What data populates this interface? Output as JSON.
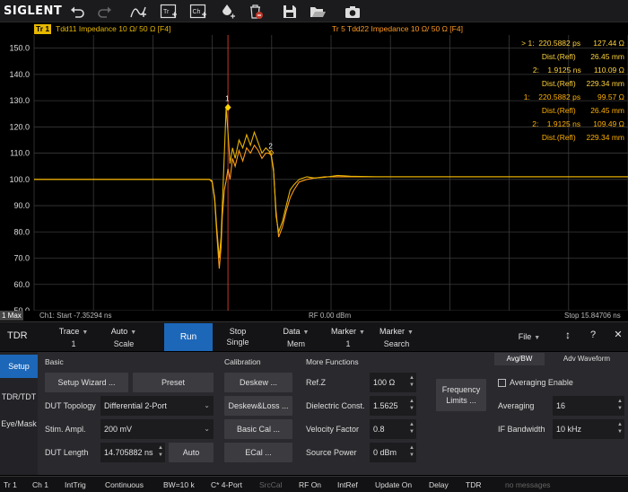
{
  "toolbar": {
    "logo": "SIGLENT",
    "icons": [
      "undo-icon",
      "redo-icon",
      "autoscale-icon",
      "trace-icon",
      "channel-icon",
      "marker-icon",
      "delete-icon",
      "save-icon",
      "open-icon",
      "screenshot-icon"
    ],
    "trace_badge": "Tr",
    "channel_badge": "Ch"
  },
  "trace_header": {
    "tr1_badge": "Tr 1",
    "tr1_text": "Tdd11 Impedance 10 Ω/ 50 Ω [F4]",
    "tr5_text": "Tr 5   Tdd22 Impedance 10 Ω/ 50 Ω [F4]"
  },
  "markers": {
    "tr1": [
      {
        "prefix": "> 1:",
        "x": "220.5882 ps",
        "y": "127.44 Ω",
        "dist_label": "Dist.(Refl)",
        "dist": "26.45 mm"
      },
      {
        "prefix": "2:",
        "x": "1.9125 ns",
        "y": "110.09 Ω",
        "dist_label": "Dist.(Refl)",
        "dist": "229.34 mm"
      }
    ],
    "tr5": [
      {
        "prefix": "1:",
        "x": "220.5882 ps",
        "y": "99.57 Ω",
        "dist_label": "Dist.(Refl)",
        "dist": "26.45 mm"
      },
      {
        "prefix": "2:",
        "x": "1.9125 ns",
        "y": "109.49 Ω",
        "dist_label": "Dist.(Refl)",
        "dist": "229.34 mm"
      }
    ],
    "on_trace_labels": [
      "1",
      "2"
    ]
  },
  "chart_data": {
    "type": "line",
    "xlabel": "",
    "ylabel": "",
    "ylim": [
      50,
      155
    ],
    "yticks": [
      150.0,
      140.0,
      130.0,
      120.0,
      110.0,
      100.0,
      90.0,
      80.0,
      70.0,
      60.0,
      50.0
    ],
    "xlim": [
      -7.35294,
      15.84706
    ],
    "x_unit": "ns",
    "grid": true,
    "colors": {
      "tr1": "#e8b400",
      "tr5": "#ff9c1a",
      "cursor": "#c0392b"
    },
    "series": [
      {
        "x": [
          -7.353,
          -3.0,
          -0.5,
          -0.4,
          -0.3,
          -0.22,
          -0.12,
          -0.05,
          0.0,
          0.08,
          0.15,
          0.22,
          0.3,
          0.4,
          0.5,
          0.65,
          0.8,
          0.95,
          1.1,
          1.25,
          1.4,
          1.55,
          1.7,
          1.8,
          1.9,
          2.0,
          2.1,
          2.2,
          2.35,
          2.5,
          2.65,
          2.8,
          3.0,
          3.3,
          3.6,
          4.0,
          4.5,
          5.0,
          6.0,
          8.0,
          10.0,
          12.0,
          15.847
        ],
        "y": [
          100.0,
          100.0,
          100.0,
          99.5,
          93.0,
          82.0,
          70.0,
          78.0,
          90.0,
          110.0,
          127.44,
          118.0,
          106.0,
          112.0,
          108.0,
          115.0,
          112.0,
          117.0,
          113.0,
          118.0,
          114.0,
          110.0,
          112.0,
          111.0,
          110.09,
          104.0,
          86.0,
          80.0,
          84.0,
          90.0,
          96.0,
          98.0,
          100.0,
          101.0,
          100.5,
          100.8,
          101.5,
          101.2,
          101.0,
          101.0,
          101.0,
          101.0,
          101.0
        ]
      },
      {
        "x": [
          -7.353,
          -3.0,
          -0.5,
          -0.4,
          -0.3,
          -0.22,
          -0.12,
          -0.05,
          0.0,
          0.08,
          0.15,
          0.22,
          0.3,
          0.4,
          0.5,
          0.65,
          0.8,
          0.95,
          1.1,
          1.25,
          1.4,
          1.55,
          1.7,
          1.8,
          1.9,
          2.0,
          2.1,
          2.2,
          2.35,
          2.5,
          2.65,
          2.8,
          3.0,
          3.3,
          3.6,
          4.0,
          4.5,
          5.0,
          6.0,
          8.0,
          10.0,
          12.0,
          15.847
        ],
        "y": [
          100.0,
          100.0,
          100.0,
          99.0,
          92.0,
          80.0,
          66.0,
          74.0,
          86.0,
          96.0,
          99.57,
          104.0,
          100.0,
          108.0,
          105.0,
          111.0,
          107.0,
          112.0,
          110.0,
          113.0,
          111.0,
          108.0,
          110.0,
          110.0,
          109.49,
          103.0,
          88.0,
          78.0,
          82.0,
          88.0,
          93.0,
          96.0,
          99.0,
          100.0,
          100.5,
          101.0,
          101.0,
          101.0,
          101.0,
          101.0,
          101.0,
          101.0,
          101.0
        ]
      }
    ]
  },
  "scale_bar": {
    "max_tag": "1 Max",
    "start": "Ch1: Start -7.35294 ns",
    "center": "RF 0.00 dBm",
    "stop": "Stop 15.84706 ns"
  },
  "menu": {
    "tdr": "TDR",
    "trace": {
      "label": "Trace",
      "value": "1"
    },
    "autoscale": {
      "label": "Auto",
      "sub": "Scale"
    },
    "run": "Run",
    "stop": {
      "label": "Stop",
      "sub": "Single"
    },
    "data": {
      "label": "Data",
      "sub": "Mem"
    },
    "marker": {
      "label": "Marker",
      "value": "1"
    },
    "marker_search": {
      "label": "Marker",
      "sub": "Search"
    },
    "file": "File",
    "move": "↕",
    "help": "?",
    "close": "✕"
  },
  "side_tabs": [
    "Setup",
    "TDR/TDT",
    "Eye/Mask"
  ],
  "basic": {
    "heading": "Basic",
    "setup_wizard": "Setup Wizard ...",
    "preset": "Preset",
    "dut_topology_label": "DUT Topology",
    "dut_topology_value": "Differential 2-Port",
    "stim_ampl_label": "Stim. Ampl.",
    "stim_ampl_value": "200 mV",
    "dut_length_label": "DUT Length",
    "dut_length_value": "14.705882 ns",
    "auto": "Auto"
  },
  "calibration": {
    "heading": "Calibration",
    "deskew": "Deskew ...",
    "deskew_loss": "Deskew&Loss ...",
    "basic_cal": "Basic Cal ...",
    "ecal": "ECal ..."
  },
  "more_functions": {
    "heading": "More Functions",
    "refz_label": "Ref.Z",
    "refz_value": "100 Ω",
    "dielectric_label": "Dielectric Const.",
    "dielectric_value": "1.5625",
    "velocity_label": "Velocity Factor",
    "velocity_value": "0.8",
    "source_power_label": "Source Power",
    "source_power_value": "0 dBm",
    "freq_limits_line1": "Frequency",
    "freq_limits_line2": "Limits ..."
  },
  "avg": {
    "tab_avgbw": "Avg/BW",
    "tab_adv": "Adv Waveform",
    "averaging_enable": "Averaging Enable",
    "averaging_label": "Averaging",
    "averaging_value": "16",
    "ifbw_label": "IF Bandwidth",
    "ifbw_value": "10 kHz"
  },
  "status_bar": [
    "Tr 1",
    "Ch 1",
    "IntTrig",
    "Continuous",
    "BW=10 k",
    "C* 4-Port",
    "SrcCal",
    "RF On",
    "IntRef",
    "Update On",
    "Delay",
    "TDR",
    "no messages"
  ]
}
